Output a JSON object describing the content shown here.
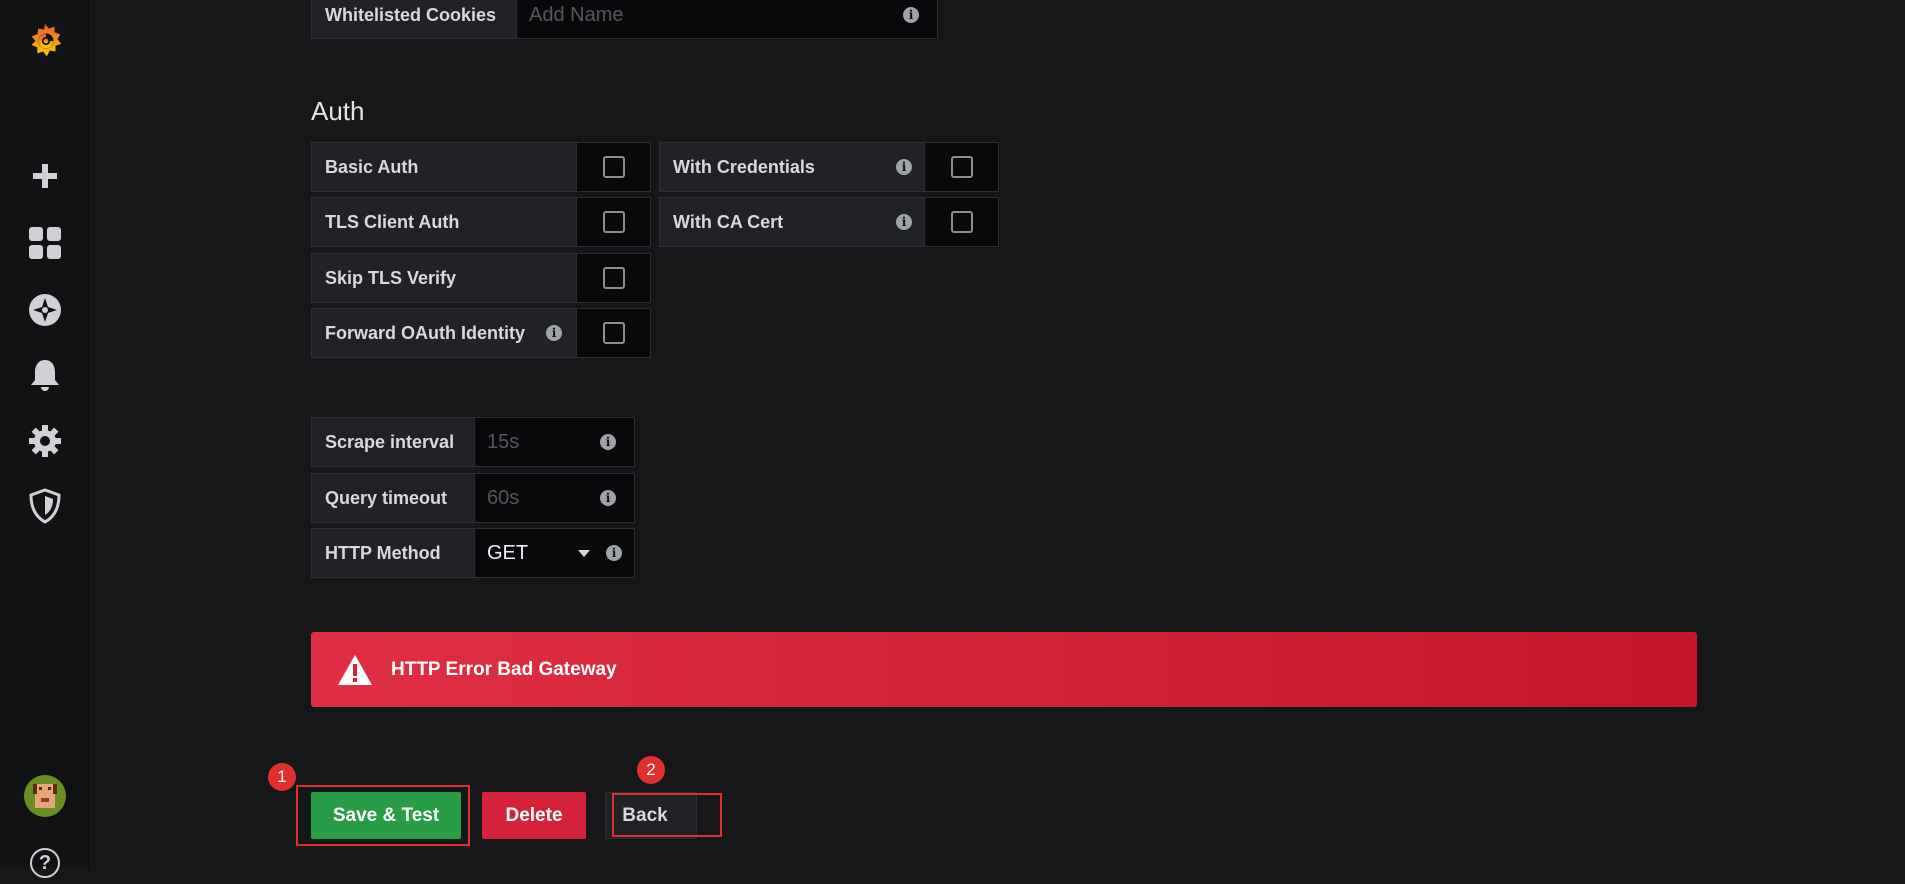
{
  "sidebar": {
    "logo": "grafana-logo-icon",
    "items": [
      {
        "icon": "plus-icon"
      },
      {
        "icon": "dashboards-icon"
      },
      {
        "icon": "explore-compass-icon"
      },
      {
        "icon": "alerting-bell-icon"
      },
      {
        "icon": "configuration-gear-icon"
      },
      {
        "icon": "server-admin-shield-icon"
      }
    ],
    "avatar": "avatar-icon",
    "help": "?"
  },
  "whitelisted": {
    "label": "Whitelisted Cookies",
    "placeholder": "Add Name"
  },
  "auth": {
    "title": "Auth",
    "basic_auth": "Basic Auth",
    "with_credentials": "With Credentials",
    "tls_client_auth": "TLS Client Auth",
    "with_ca_cert": "With CA Cert",
    "skip_tls_verify": "Skip TLS Verify",
    "forward_oauth": "Forward OAuth Identity"
  },
  "settings": {
    "scrape_interval": {
      "label": "Scrape interval",
      "placeholder": "15s"
    },
    "query_timeout": {
      "label": "Query timeout",
      "placeholder": "60s"
    },
    "http_method": {
      "label": "HTTP Method",
      "value": "GET"
    }
  },
  "alert": {
    "message": "HTTP Error Bad Gateway"
  },
  "buttons": {
    "save_test": "Save & Test",
    "delete": "Delete",
    "back": "Back"
  },
  "annotations": {
    "badge1": "1",
    "badge2": "2"
  },
  "colors": {
    "success": "#299c46",
    "danger": "#e02f44",
    "highlight": "#e02f2f"
  }
}
